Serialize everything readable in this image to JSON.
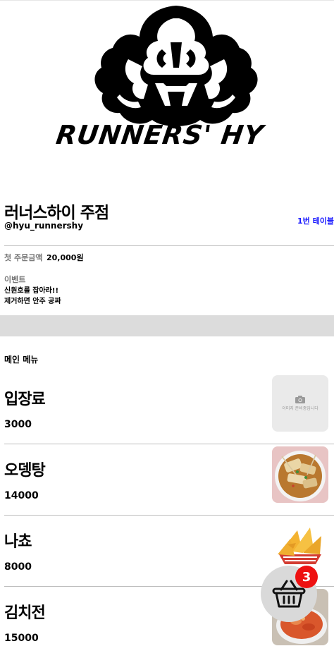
{
  "logo": {
    "text": "RUNNERS' HY"
  },
  "store": {
    "name": "러너스하이 주점",
    "handle": "@hyu_runnershy",
    "table_label": "1번 테이블"
  },
  "info": {
    "min_order_label": "첫 주문금액",
    "min_order_value": "20,000원",
    "event_title": "이벤트",
    "event_lines": [
      "신원호를 잡아라!!",
      "제거하면 안주 공짜"
    ]
  },
  "menu": {
    "section_title": "메인 메뉴",
    "items": [
      {
        "name": "입장료",
        "price": "3000",
        "image": "no-image",
        "no_image_text": "이미지 준비중입니다"
      },
      {
        "name": "오뎅탕",
        "price": "14000",
        "image": "fishcake-soup"
      },
      {
        "name": "나쵸",
        "price": "8000",
        "image": "nachos"
      },
      {
        "name": "김치전",
        "price": "15000",
        "image": "kimchi-pancake"
      }
    ]
  },
  "cart": {
    "icon": "basket-icon",
    "count": "3",
    "badge_color": "#ee1111"
  },
  "colors": {
    "table_label": "#1a1aff",
    "band": "#dcdcdc",
    "muted": "#777777"
  }
}
